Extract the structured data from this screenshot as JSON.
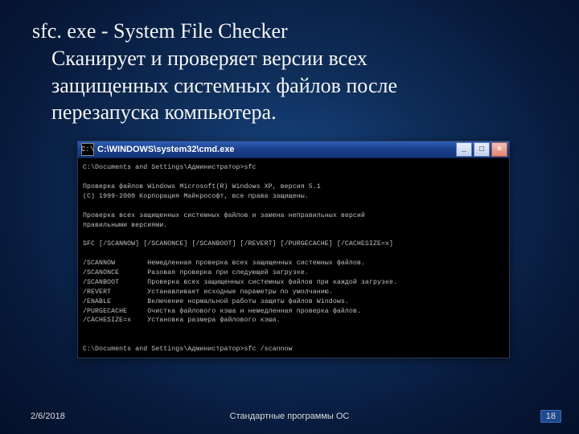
{
  "heading": {
    "title": "sfc. exe - System File Checker",
    "desc_l1": "Сканирует и проверяет версии всех",
    "desc_l2": "защищенных системных файлов после",
    "desc_l3": "перезапуска компьютера."
  },
  "cmd": {
    "icon_glyph": "C:\\",
    "title": "C:\\WINDOWS\\system32\\cmd.exe",
    "btn_min": "_",
    "btn_max": "□",
    "btn_close": "×",
    "lines": [
      "C:\\Documents and Settings\\Администратор>sfc",
      "",
      "Проверка файлов Windows Microsoft(R) Windows XP, версия 5.1",
      "(C) 1999-2000 Корпорация Майкрософт, все права защищены.",
      "",
      "Проверка всех защищенных системных файлов и замена неправильных версий",
      "правильными версиями.",
      "",
      "SFC [/SCANNOW] [/SCANONCE] [/SCANBOOT] [/REVERT] [/PURGECACHE] [/CACHESIZE=x]",
      "",
      "/SCANNOW        Немедленная проверка всех защищенных системных файлов.",
      "/SCANONCE       Разовая проверка при следующей загрузке.",
      "/SCANBOOT       Проверка всех защищенных системных файлов при каждой загрузке.",
      "/REVERT         Устанавливает исходные параметры по умолчанию.",
      "/ENABLE         Включение нормальной работы защиты файлов Windows.",
      "/PURGECACHE     Очистка файлового кэша и немедленная проверка файлов.",
      "/CACHESIZE=x    Установка размера файлового кэша.",
      "",
      "",
      "C:\\Documents and Settings\\Администратор>sfc /scannow",
      "",
      "C:\\Documents and Settings\\Администратор>"
    ]
  },
  "footer": {
    "date": "2/6/2018",
    "caption": "Стандартные программы ОС",
    "page": "18"
  }
}
